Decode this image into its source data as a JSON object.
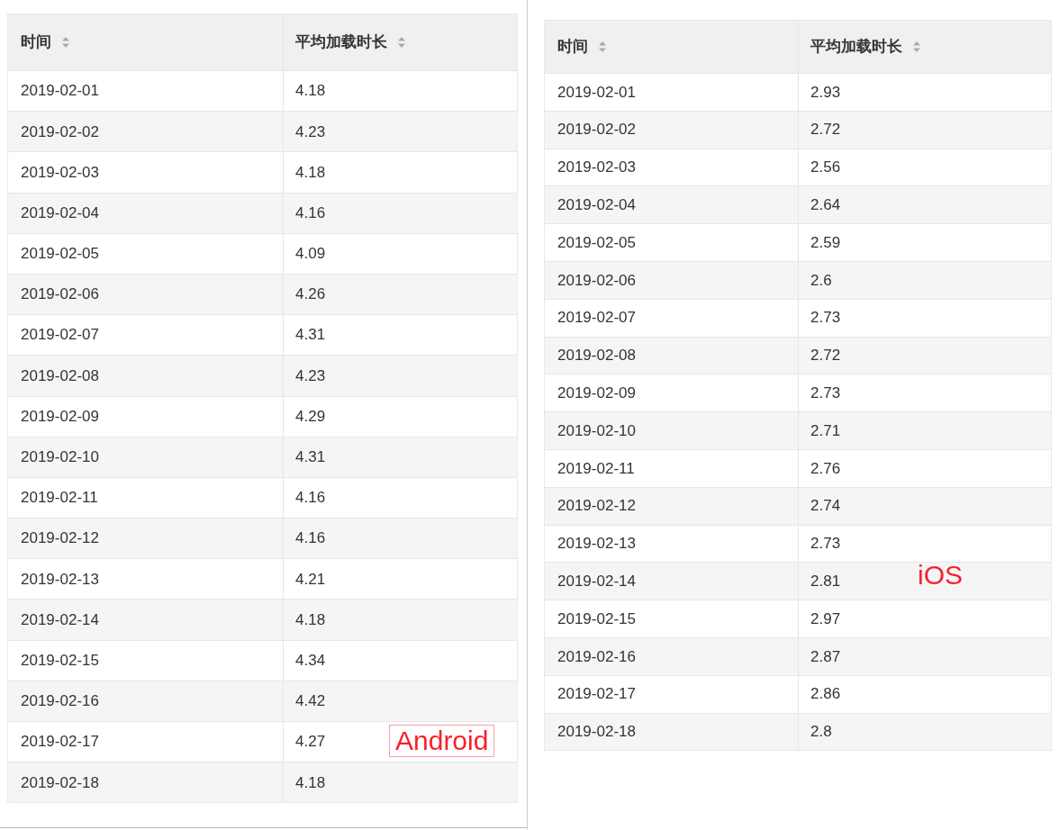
{
  "panels": [
    {
      "columns": [
        "时间",
        "平均加载时长"
      ],
      "annotation": {
        "text": "Android",
        "bordered": true
      },
      "rows": [
        [
          "2019-02-01",
          "4.18"
        ],
        [
          "2019-02-02",
          "4.23"
        ],
        [
          "2019-02-03",
          "4.18"
        ],
        [
          "2019-02-04",
          "4.16"
        ],
        [
          "2019-02-05",
          "4.09"
        ],
        [
          "2019-02-06",
          "4.26"
        ],
        [
          "2019-02-07",
          "4.31"
        ],
        [
          "2019-02-08",
          "4.23"
        ],
        [
          "2019-02-09",
          "4.29"
        ],
        [
          "2019-02-10",
          "4.31"
        ],
        [
          "2019-02-11",
          "4.16"
        ],
        [
          "2019-02-12",
          "4.16"
        ],
        [
          "2019-02-13",
          "4.21"
        ],
        [
          "2019-02-14",
          "4.18"
        ],
        [
          "2019-02-15",
          "4.34"
        ],
        [
          "2019-02-16",
          "4.42"
        ],
        [
          "2019-02-17",
          "4.27"
        ],
        [
          "2019-02-18",
          "4.18"
        ]
      ]
    },
    {
      "columns": [
        "时间",
        "平均加载时长"
      ],
      "annotation": {
        "text": "iOS",
        "bordered": false
      },
      "rows": [
        [
          "2019-02-01",
          "2.93"
        ],
        [
          "2019-02-02",
          "2.72"
        ],
        [
          "2019-02-03",
          "2.56"
        ],
        [
          "2019-02-04",
          "2.64"
        ],
        [
          "2019-02-05",
          "2.59"
        ],
        [
          "2019-02-06",
          "2.6"
        ],
        [
          "2019-02-07",
          "2.73"
        ],
        [
          "2019-02-08",
          "2.72"
        ],
        [
          "2019-02-09",
          "2.73"
        ],
        [
          "2019-02-10",
          "2.71"
        ],
        [
          "2019-02-11",
          "2.76"
        ],
        [
          "2019-02-12",
          "2.74"
        ],
        [
          "2019-02-13",
          "2.73"
        ],
        [
          "2019-02-14",
          "2.81"
        ],
        [
          "2019-02-15",
          "2.97"
        ],
        [
          "2019-02-16",
          "2.87"
        ],
        [
          "2019-02-17",
          "2.86"
        ],
        [
          "2019-02-18",
          "2.8"
        ]
      ]
    }
  ]
}
